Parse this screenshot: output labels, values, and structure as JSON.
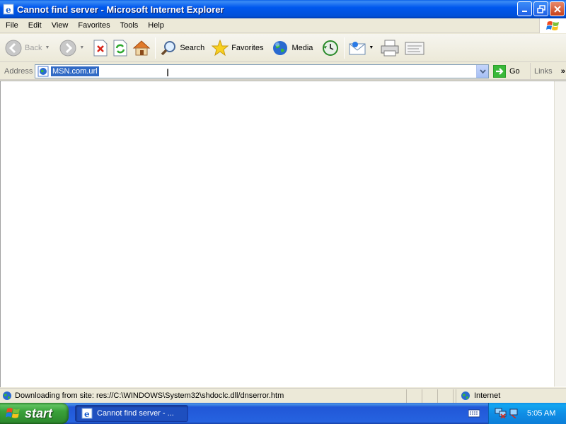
{
  "window": {
    "title": "Cannot find server - Microsoft Internet Explorer"
  },
  "menu": [
    "File",
    "Edit",
    "View",
    "Favorites",
    "Tools",
    "Help"
  ],
  "toolbar": {
    "back_label": "Back",
    "search_label": "Search",
    "favorites_label": "Favorites",
    "media_label": "Media"
  },
  "address": {
    "label": "Address",
    "value": "MSN.com.url",
    "go_label": "Go",
    "links_label": "Links"
  },
  "status": {
    "text": "Downloading from site: res://C:\\WINDOWS\\System32\\shdoclc.dll/dnserror.htm",
    "zone": "Internet"
  },
  "taskbar": {
    "start_label": "start",
    "task_label": "Cannot find server - ...",
    "clock": "5:05 AM"
  },
  "colors": {
    "titlebar": "#0058ee",
    "start": "#3aa13a",
    "tray": "#0f8ee6",
    "selection": "#316ac5"
  }
}
